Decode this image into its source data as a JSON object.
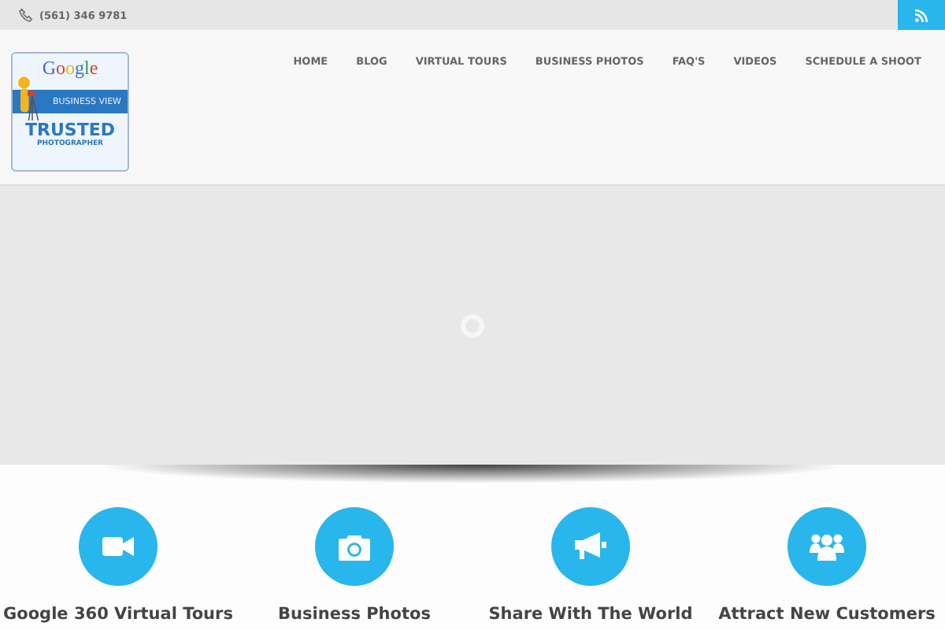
{
  "topbar": {
    "phone": "(561) 346 9781"
  },
  "badge": {
    "brand": "Google",
    "band": "BUSINESS VIEW",
    "title": "TRUSTED",
    "subtitle": "PHOTOGRAPHER"
  },
  "nav": [
    {
      "label": "HOME"
    },
    {
      "label": "BLOG"
    },
    {
      "label": "VIRTUAL TOURS"
    },
    {
      "label": "BUSINESS PHOTOS"
    },
    {
      "label": "FAQ'S"
    },
    {
      "label": "VIDEOS"
    },
    {
      "label": "SCHEDULE A SHOOT"
    }
  ],
  "features": [
    {
      "kind": "video",
      "title": "Google 360 Virtual Tours"
    },
    {
      "kind": "camera",
      "title": "Business Photos"
    },
    {
      "kind": "megaphone",
      "title": "Share With The World"
    },
    {
      "kind": "users",
      "title": "Attract New Customers"
    }
  ]
}
